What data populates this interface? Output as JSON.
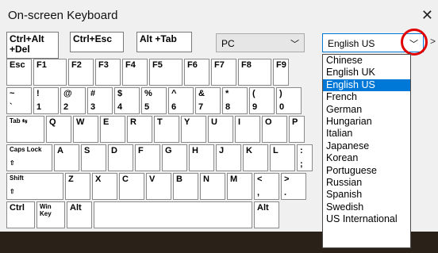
{
  "window": {
    "title": "On-screen Keyboard",
    "close_glyph": "✕"
  },
  "toolbar": {
    "ctrl_alt_del": "Ctrl+Alt\n+Del",
    "ctrl_esc": "Ctrl+Esc",
    "alt_tab": "Alt +Tab",
    "layout_combo": "PC",
    "language_combo": "English US",
    "more_glyph": ">"
  },
  "keyboard": {
    "row1": [
      {
        "top": "Esc",
        "bottom": ""
      },
      {
        "top": "F1",
        "bottom": ""
      },
      {
        "top": "F2",
        "bottom": ""
      },
      {
        "top": "F3",
        "bottom": ""
      },
      {
        "top": "F4",
        "bottom": ""
      },
      {
        "top": "F5",
        "bottom": ""
      },
      {
        "top": "F6",
        "bottom": ""
      },
      {
        "top": "F7",
        "bottom": ""
      },
      {
        "top": "F8",
        "bottom": ""
      },
      {
        "top": "F9",
        "bottom": ""
      }
    ],
    "row2": [
      {
        "top": "~",
        "bottom": "`"
      },
      {
        "top": "!",
        "bottom": "1"
      },
      {
        "top": "@",
        "bottom": "2"
      },
      {
        "top": "#",
        "bottom": "3"
      },
      {
        "top": "$",
        "bottom": "4"
      },
      {
        "top": "%",
        "bottom": "5"
      },
      {
        "top": "^",
        "bottom": "6"
      },
      {
        "top": "&",
        "bottom": "7"
      },
      {
        "top": "*",
        "bottom": "8"
      },
      {
        "top": "(",
        "bottom": "9"
      },
      {
        "top": ")",
        "bottom": "0"
      }
    ],
    "row3": [
      {
        "top": "Tab ⇆",
        "bottom": ""
      },
      {
        "top": "Q",
        "bottom": ""
      },
      {
        "top": "W",
        "bottom": ""
      },
      {
        "top": "E",
        "bottom": ""
      },
      {
        "top": "R",
        "bottom": ""
      },
      {
        "top": "T",
        "bottom": ""
      },
      {
        "top": "Y",
        "bottom": ""
      },
      {
        "top": "U",
        "bottom": ""
      },
      {
        "top": "I",
        "bottom": ""
      },
      {
        "top": "O",
        "bottom": ""
      },
      {
        "top": "P",
        "bottom": ""
      }
    ],
    "row4": [
      {
        "top": "Caps Lock",
        "bottom": "⇧"
      },
      {
        "top": "A",
        "bottom": ""
      },
      {
        "top": "S",
        "bottom": ""
      },
      {
        "top": "D",
        "bottom": ""
      },
      {
        "top": "F",
        "bottom": ""
      },
      {
        "top": "G",
        "bottom": ""
      },
      {
        "top": "H",
        "bottom": ""
      },
      {
        "top": "J",
        "bottom": ""
      },
      {
        "top": "K",
        "bottom": ""
      },
      {
        "top": "L",
        "bottom": ""
      },
      {
        "top": ":",
        "bottom": ";"
      }
    ],
    "row5": [
      {
        "top": "Shift",
        "bottom": "⇧"
      },
      {
        "top": "Z",
        "bottom": ""
      },
      {
        "top": "X",
        "bottom": ""
      },
      {
        "top": "C",
        "bottom": ""
      },
      {
        "top": "V",
        "bottom": ""
      },
      {
        "top": "B",
        "bottom": ""
      },
      {
        "top": "N",
        "bottom": ""
      },
      {
        "top": "M",
        "bottom": ""
      },
      {
        "top": "<",
        "bottom": ","
      },
      {
        "top": ">",
        "bottom": "."
      }
    ],
    "row6": [
      {
        "top": "Ctrl",
        "bottom": ""
      },
      {
        "top": "Win\nKey",
        "bottom": ""
      },
      {
        "top": "Alt",
        "bottom": ""
      },
      {
        "top": "",
        "bottom": ""
      },
      {
        "top": "Alt",
        "bottom": ""
      }
    ]
  },
  "language_options": [
    {
      "label": "Chinese",
      "selected": false
    },
    {
      "label": "English UK",
      "selected": false
    },
    {
      "label": "English US",
      "selected": true
    },
    {
      "label": "French",
      "selected": false
    },
    {
      "label": "German",
      "selected": false
    },
    {
      "label": "Hungarian",
      "selected": false
    },
    {
      "label": "Italian",
      "selected": false
    },
    {
      "label": "Japanese",
      "selected": false
    },
    {
      "label": "Korean",
      "selected": false
    },
    {
      "label": "Portuguese",
      "selected": false
    },
    {
      "label": "Russian",
      "selected": false
    },
    {
      "label": "Spanish",
      "selected": false
    },
    {
      "label": "Swedish",
      "selected": false
    },
    {
      "label": "US International",
      "selected": false
    }
  ],
  "colors": {
    "selection": "#0078d7",
    "highlight_circle": "#e00000"
  }
}
